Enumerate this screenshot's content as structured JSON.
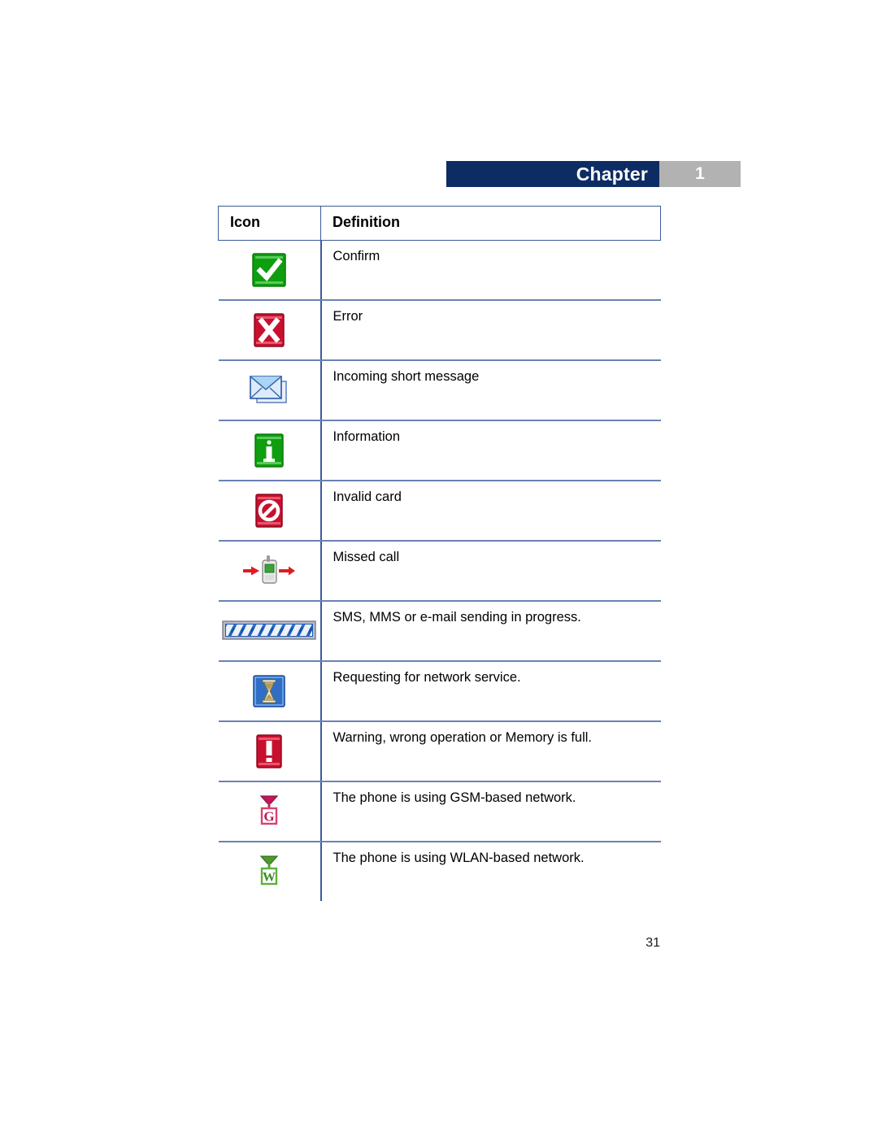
{
  "header": {
    "chapter_label": "Chapter",
    "chapter_number": "1",
    "banner_color": "#0d2c64",
    "number_box_color": "#b2b2b2"
  },
  "table": {
    "columns": [
      {
        "key": "icon",
        "label": "Icon"
      },
      {
        "key": "definition",
        "label": "Definition"
      }
    ],
    "rows": [
      {
        "icon_name": "confirm-icon",
        "definition": "Confirm"
      },
      {
        "icon_name": "error-icon",
        "definition": "Error"
      },
      {
        "icon_name": "incoming-message-icon",
        "definition": "Incoming short message"
      },
      {
        "icon_name": "information-icon",
        "definition": "Information"
      },
      {
        "icon_name": "invalid-card-icon",
        "definition": "Invalid card"
      },
      {
        "icon_name": "missed-call-icon",
        "definition": "Missed call"
      },
      {
        "icon_name": "sending-progress-icon",
        "definition": "SMS, MMS or e-mail sending in progress."
      },
      {
        "icon_name": "hourglass-icon",
        "definition": "Requesting for network service."
      },
      {
        "icon_name": "warning-icon",
        "definition": "Warning, wrong operation or Memory is full."
      },
      {
        "icon_name": "gsm-network-icon",
        "definition": "The phone is using GSM-based network."
      },
      {
        "icon_name": "wlan-network-icon",
        "definition": "The phone is using WLAN-based network."
      }
    ]
  },
  "footer": {
    "page_number": "31"
  },
  "colors": {
    "table_border": "#3c5a96",
    "row_divider": "#6a82b4",
    "column_divider": "#3b5aa0",
    "green": "#1aa318",
    "red": "#cf1b3b",
    "blue": "#2f6ec4",
    "crimson": "#c2185b",
    "leaf_green": "#4d9b2e"
  }
}
